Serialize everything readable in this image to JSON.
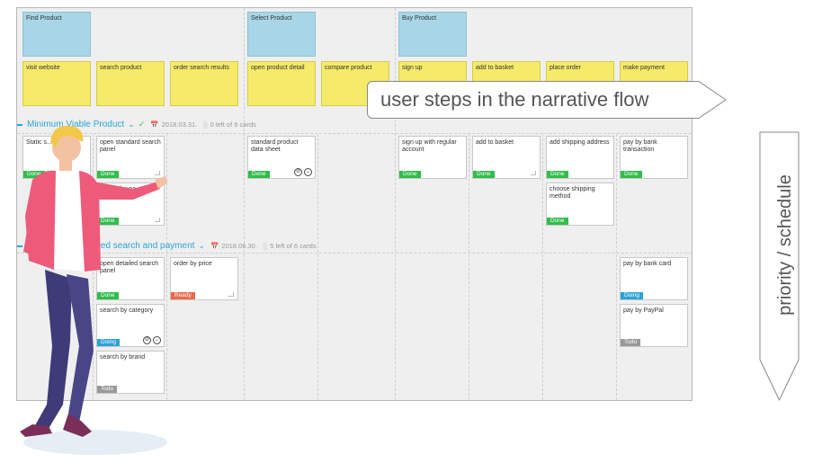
{
  "activities": [
    "Find Product",
    "Select Product",
    "Buy Product"
  ],
  "tasks": [
    "visit website",
    "search product",
    "order search results",
    "open product detail",
    "compare product",
    "sign up",
    "add to basket",
    "place order",
    "make payment"
  ],
  "releases": [
    {
      "name": "Minimum Viable Product",
      "date": "2018.03.31.",
      "count": "0 left of 9 cards"
    },
    {
      "name": "Improved search and payment",
      "visible_name": "roved search and payment",
      "date": "2018.06.30.",
      "count": "5 left of 6 cards"
    }
  ],
  "stories": {
    "r1": [
      {
        "text": "Static s... templ...",
        "status": "Done"
      },
      {
        "text": "open standard search panel",
        "status": "Done"
      },
      {
        "text": "search by na...",
        "status": "Done"
      },
      {
        "text": "standard product data sheet",
        "status": "Done"
      },
      {
        "text": "sign up with regular account",
        "status": "Done"
      },
      {
        "text": "add to basket",
        "status": "Done"
      },
      {
        "text": "add shipping address",
        "status": "Done"
      },
      {
        "text": "choose shipping method",
        "status": "Done"
      },
      {
        "text": "pay by bank transaction",
        "status": "Done"
      }
    ],
    "r2": [
      {
        "text": "open detailed search panel",
        "status": "Done"
      },
      {
        "text": "order by price",
        "status": "Ready"
      },
      {
        "text": "search by category",
        "status": "Doing"
      },
      {
        "text": "search by brand",
        "status": "Todo"
      },
      {
        "text": "pay by bank card",
        "status": "Doing"
      },
      {
        "text": "pay by PayPal",
        "status": "Todo"
      }
    ]
  },
  "callout": "user steps in the narrative flow",
  "side_label": "priority / schedule",
  "colors": {
    "done": "#2fbe4b",
    "doing": "#2aa4d8",
    "ready": "#ea6a4a",
    "todo": "#999999",
    "activity": "#a8d6e6",
    "task": "#f5ea6a"
  },
  "icons": {
    "release-toggle": "chevron-down-icon",
    "release-status": "check-icon",
    "date": "calendar-icon",
    "count": "bar-chart-icon",
    "card-action": "circle-edit-icon"
  }
}
